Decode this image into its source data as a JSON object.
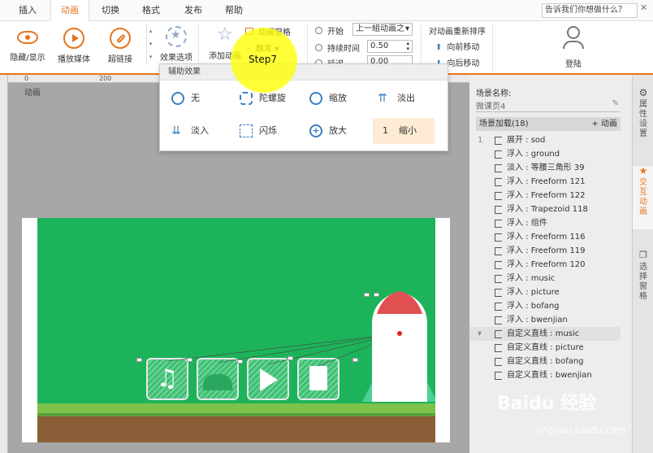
{
  "menu": {
    "tabs": [
      "插入",
      "动画",
      "切换",
      "格式",
      "发布",
      "帮助"
    ],
    "active": "动画",
    "help_placeholder": "告诉我们你想做什么？"
  },
  "ribbon": {
    "hide_show": "隐藏/显示",
    "play_media": "播放媒体",
    "hyperlink": "超链接",
    "effect_options": "效果选项",
    "add_animation": "添加动画",
    "animation_pane": "动画窗格",
    "trigger": "触发",
    "start_label": "开始",
    "start_value": "上一組动画之",
    "duration_label": "持续时间",
    "duration_value": "0.50",
    "delay_label": "延迟",
    "delay_value": "0.00",
    "reorder_title": "对动画重新排序",
    "move_earlier": "向前移动",
    "move_later": "向后移动",
    "login": "登陆",
    "group_label": "动画"
  },
  "ruler": {
    "tick0": "0",
    "tick200": "200"
  },
  "popup": {
    "title": "辅助效果",
    "options": [
      "无",
      "陀螺旋",
      "缩放",
      "淡出",
      "淡入",
      "闪烁",
      "放大",
      "缩小"
    ],
    "shrink_prefix": "1"
  },
  "step": "Step7",
  "panel": {
    "scene_name_label": "场景名称:",
    "scene_name_value": "微课页4",
    "list_title": "场景加载(18)",
    "add_anim": "+ 动画",
    "items": [
      {
        "num": "1",
        "text": "展开 : sod"
      },
      {
        "num": "",
        "text": "浮入 : ground"
      },
      {
        "num": "",
        "text": "淡入 : 等腰三角形 39"
      },
      {
        "num": "",
        "text": "浮入 : Freeform 121"
      },
      {
        "num": "",
        "text": "浮入 : Freeform 122"
      },
      {
        "num": "",
        "text": "浮入 : Trapezoid 118"
      },
      {
        "num": "",
        "text": "浮入 : 组件"
      },
      {
        "num": "",
        "text": "浮入 : Freeform 116"
      },
      {
        "num": "",
        "text": "浮入 : Freeform 119"
      },
      {
        "num": "",
        "text": "浮入 : Freeform 120"
      },
      {
        "num": "",
        "text": "浮入 : music"
      },
      {
        "num": "",
        "text": "浮入 : picture"
      },
      {
        "num": "",
        "text": "浮入 : bofang"
      },
      {
        "num": "",
        "text": "浮入 : bwenjian"
      },
      {
        "num": "▾",
        "text": "自定义直线 : music"
      },
      {
        "num": "",
        "text": "自定义直线 : picture"
      },
      {
        "num": "",
        "text": "自定义直线 : bofang"
      },
      {
        "num": "",
        "text": "自定义直线 : bwenjian"
      }
    ]
  },
  "sidebar": {
    "properties": "属性设置",
    "interactive": "交互动画",
    "selection": "选择窗格"
  },
  "watermark": {
    "brand": "Baidu 经验",
    "url": "jingyan.baidu.com"
  },
  "colors": {
    "accent": "#e8741c",
    "scene_green": "#1db35a",
    "ground_brown": "#8a5f37",
    "rocket_red": "#e05050"
  }
}
